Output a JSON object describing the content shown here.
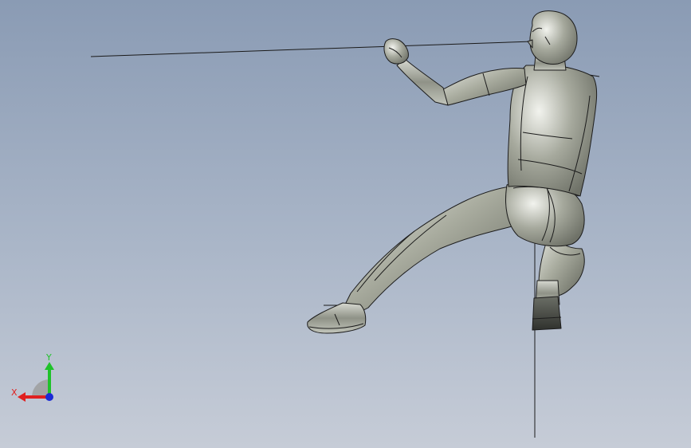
{
  "viewport": {
    "background_top": "#8a9bb4",
    "background_bottom": "#c6ccd7"
  },
  "model": {
    "type": "3d-human-figure-climbing-rope",
    "shade_color": "#b9bcb3",
    "edge_color": "#1c1c1c"
  },
  "triad": {
    "x_label": "X",
    "y_label": "Y",
    "x_color": "#e02020",
    "y_color": "#1fc22a",
    "z_color": "#1b2bd6"
  }
}
